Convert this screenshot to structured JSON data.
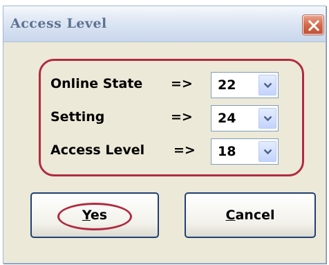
{
  "dialog": {
    "title": "Access Level",
    "close_icon": "close-icon",
    "colors": {
      "highlight": "#B12A3F",
      "close_button": "#D26747",
      "window_face": "#ECE9D8"
    }
  },
  "levels": [
    {
      "label": "Online State",
      "arrow": "=>",
      "value": "22"
    },
    {
      "label": "Setting",
      "arrow": "=>",
      "value": "24"
    },
    {
      "label": "Access Level",
      "arrow": "=>",
      "value": "18"
    }
  ],
  "buttons": {
    "yes": {
      "mnemonic": "Y",
      "rest": "es"
    },
    "cancel": {
      "mnemonic": "C",
      "rest": "ancel"
    }
  }
}
